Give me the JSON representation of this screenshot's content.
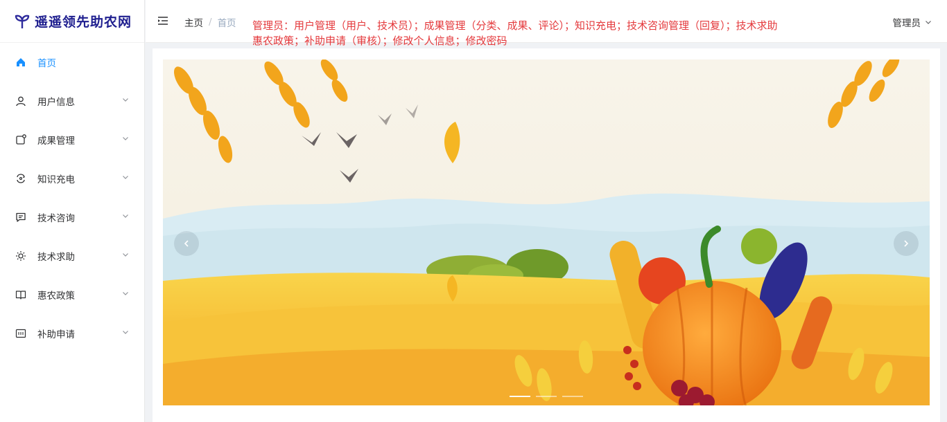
{
  "logo": {
    "text": "遥遥领先助农网",
    "icon": "sprout-icon"
  },
  "sidebar": {
    "items": [
      {
        "label": "首页",
        "icon": "home-icon",
        "active": true
      },
      {
        "label": "用户信息",
        "icon": "user-icon"
      },
      {
        "label": "成果管理",
        "icon": "document-icon"
      },
      {
        "label": "知识充电",
        "icon": "refresh-icon"
      },
      {
        "label": "技术咨询",
        "icon": "chat-icon"
      },
      {
        "label": "技术求助",
        "icon": "sun-icon"
      },
      {
        "label": "惠农政策",
        "icon": "book-icon"
      },
      {
        "label": "补助申请",
        "icon": "form-icon"
      }
    ]
  },
  "header": {
    "breadcrumb": {
      "home": "主页",
      "separator": "/",
      "current": "首页"
    },
    "notice_line1": "管理员：用户管理（用户、技术员）；成果管理（分类、成果、评论）；知识充电；技术咨询管理（回复）；技术求助",
    "notice_line2": "惠农政策；补助申请（审核）；修改个人信息；修改密码",
    "user_label": "管理员"
  },
  "carousel": {
    "prev_icon": "chevron-left-icon",
    "next_icon": "chevron-right-icon",
    "active_index": 0,
    "slide_count": 3
  },
  "colors": {
    "accent": "#1890ff",
    "notice": "#e4393c",
    "brand": "#1f1f8f"
  }
}
